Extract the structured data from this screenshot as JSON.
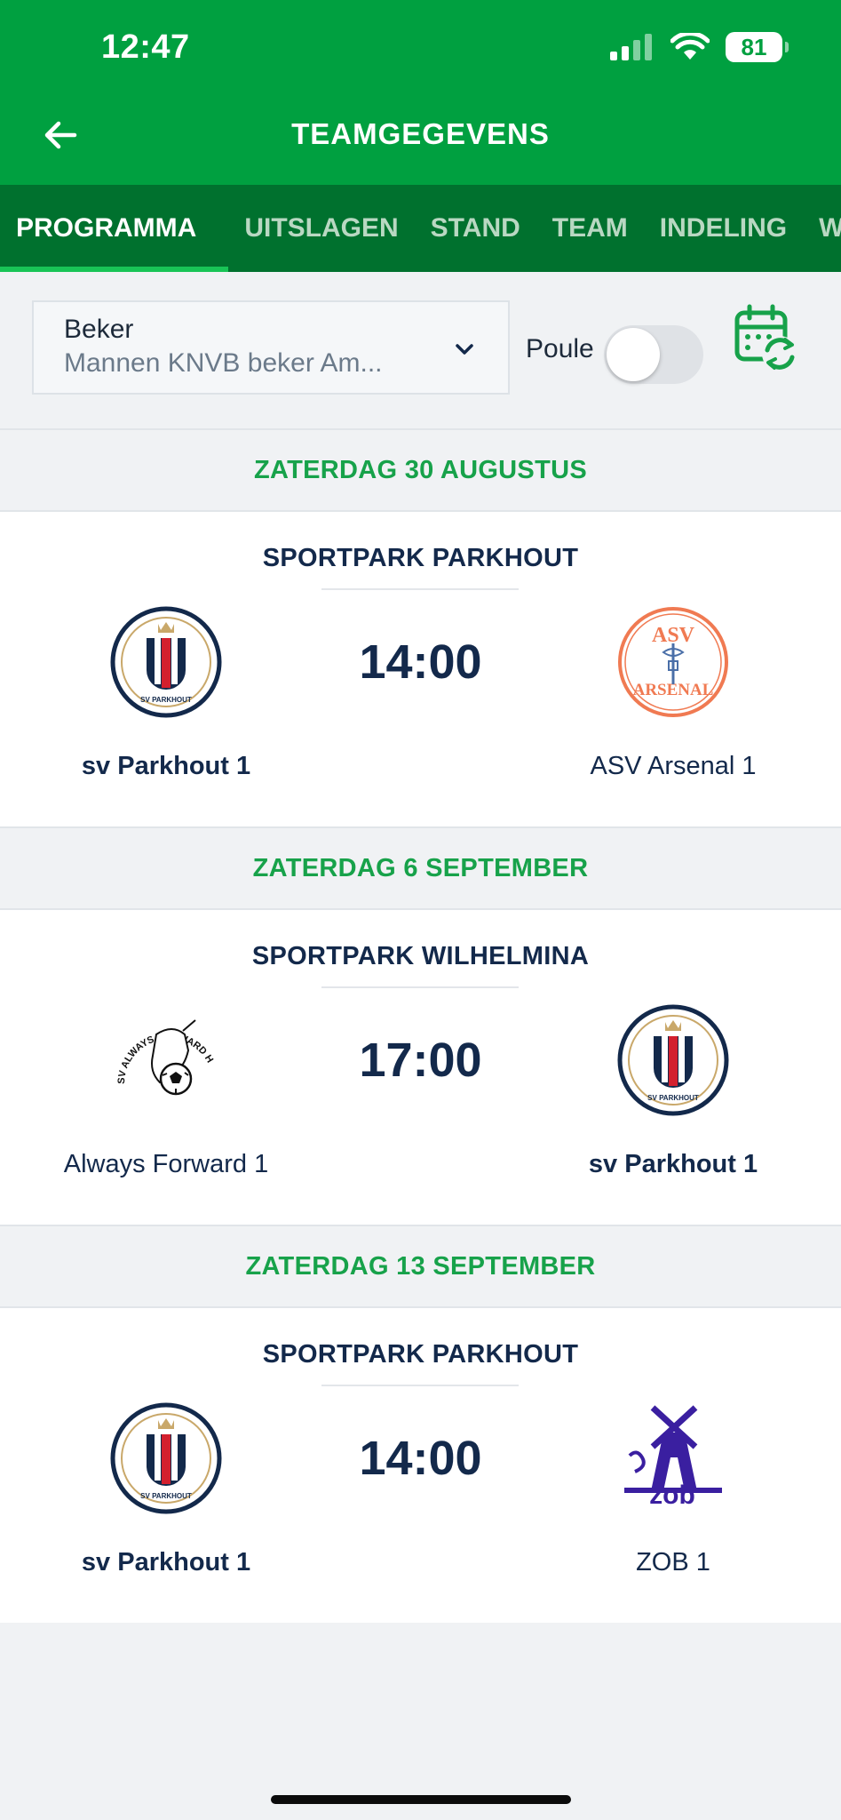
{
  "status_bar": {
    "time": "12:47",
    "battery": "81"
  },
  "header": {
    "title": "TEAMGEGEVENS"
  },
  "tabs": [
    {
      "label": "PROGRAMMA",
      "active": true
    },
    {
      "label": "UITSLAGEN"
    },
    {
      "label": "STAND"
    },
    {
      "label": "TEAM"
    },
    {
      "label": "INDELING"
    },
    {
      "label": "WED"
    }
  ],
  "filter": {
    "select_label": "Beker",
    "select_value": "Mannen KNVB beker Am...",
    "poule_label": "Poule",
    "poule_on": false
  },
  "days": [
    {
      "date": "ZATERDAG 30 AUGUSTUS",
      "venue": "SPORTPARK PARKHOUT",
      "time": "14:00",
      "home": {
        "name": "sv Parkhout 1",
        "logo": "sv-parkhout-logo"
      },
      "away": {
        "name": "ASV Arsenal 1",
        "logo": "asv-arsenal-logo"
      }
    },
    {
      "date": "ZATERDAG 6 SEPTEMBER",
      "venue": "SPORTPARK WILHELMINA",
      "time": "17:00",
      "home": {
        "name": "Always Forward 1",
        "logo": "always-forward-logo"
      },
      "away": {
        "name": "sv Parkhout 1",
        "logo": "sv-parkhout-logo"
      }
    },
    {
      "date": "ZATERDAG 13 SEPTEMBER",
      "venue": "SPORTPARK PARKHOUT",
      "time": "14:00",
      "home": {
        "name": "sv Parkhout 1",
        "logo": "sv-parkhout-logo"
      },
      "away": {
        "name": "ZOB 1",
        "logo": "zob-logo"
      }
    }
  ],
  "logo_text": {
    "sv_parkhout": "SV PARKHOUT",
    "asv_arsenal_top": "ASV",
    "asv_arsenal_bottom": "ARSENAL",
    "always_forward": "SV ALWAYS FORWARD HOORN",
    "zob": "zob"
  },
  "colors": {
    "primary": "#00a040",
    "tabbar": "#00712e",
    "accent": "#17a24a",
    "navy": "#13294b"
  }
}
